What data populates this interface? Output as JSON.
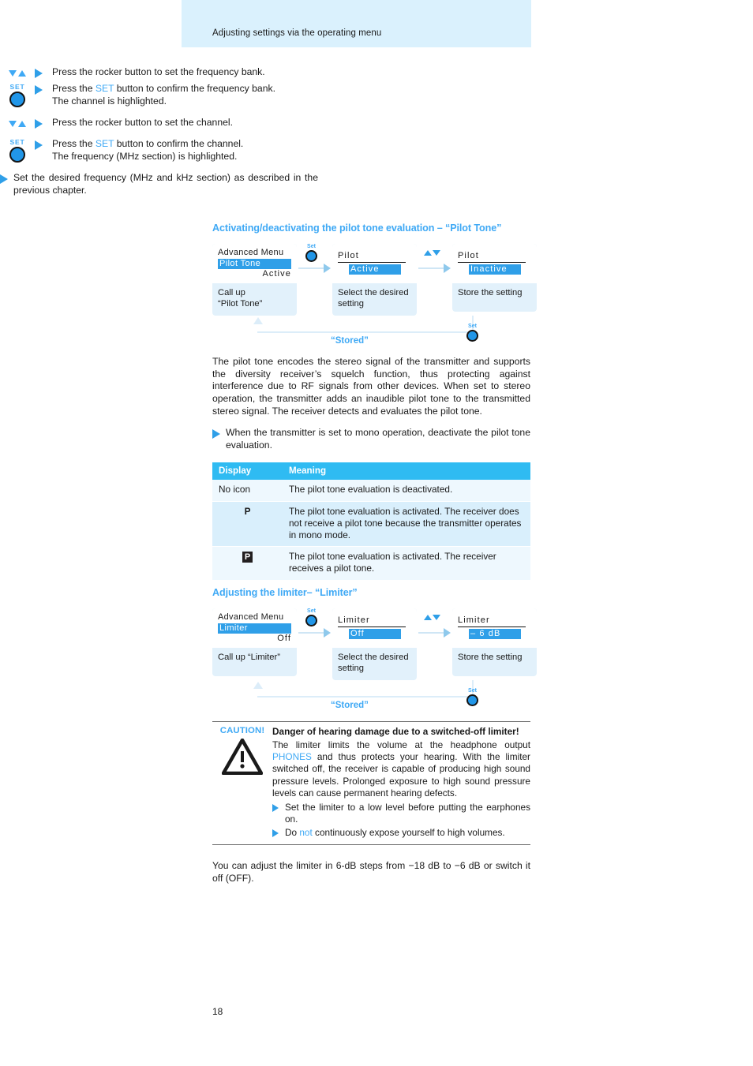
{
  "header": {
    "title": "Adjusting settings via the operating menu",
    "band_color": "#daf1fd"
  },
  "colors": {
    "accent": "#3fa9f5",
    "arrow": "#2f9fe8",
    "table_header": "#2fbbf2",
    "table_row_alt": "#d9effc",
    "table_row_plain": "#eef8fe",
    "card_body": "#e2f1fb"
  },
  "steps": [
    {
      "icon": "rocker-down-up",
      "lines": [
        "Press the rocker button to set the frequency bank."
      ]
    },
    {
      "icon": "set-button",
      "icon_label": "SET",
      "lines": [
        "Press the SET button to confirm the frequency bank.",
        "The channel is highlighted."
      ],
      "keyword": "SET"
    },
    {
      "icon": "rocker-down-up",
      "lines": [
        "Press the rocker button to set the channel."
      ]
    },
    {
      "icon": "set-button",
      "icon_label": "SET",
      "lines": [
        "Press the SET button to confirm the channel.",
        "The frequency (MHz section) is highlighted."
      ],
      "keyword": "SET"
    }
  ],
  "frequency_bullet": "Set the desired frequency (MHz and kHz section) as described in the previous chapter.",
  "pilot_section": {
    "heading": "Activating/deactivating the pilot tone evaluation – “Pilot Tone”",
    "cards": [
      {
        "screen": {
          "line1": "Advanced  Menu",
          "line2": "Pilot Tone",
          "line3": "Active"
        },
        "caption": "Call up\n“Pilot Tone”"
      },
      {
        "screen": {
          "line1": "Pilot",
          "line2": "Active"
        },
        "caption": "Select the desired setting"
      },
      {
        "screen": {
          "line1": "Pilot",
          "line2": "Inactive"
        },
        "caption": "Store the setting"
      }
    ],
    "connector1": {
      "type": "set-button",
      "label": "Set"
    },
    "connector2": {
      "type": "rocker-up-down"
    },
    "return_label": "“Stored”",
    "return_button_label": "Set"
  },
  "pilot_paragraph": "The pilot tone encodes the stereo signal of the transmitter and supports the diversity receiver’s squelch function, thus protecting against interference due to RF signals from other devices. When set to stereo operation, the transmitter adds an inaudible pilot tone to the transmitted stereo signal. The receiver detects and evaluates the pilot tone.",
  "pilot_bullet": "When the transmitter is set to mono operation, deactivate the pilot tone evaluation.",
  "table": {
    "headers": [
      "Display",
      "Meaning"
    ],
    "rows": [
      {
        "display": "No icon",
        "display_kind": "text",
        "meaning": "The pilot tone evaluation is deactivated."
      },
      {
        "display": "P",
        "display_kind": "plain-p",
        "meaning": "The pilot tone evaluation is activated. The receiver does not receive a pilot tone because the transmitter operates in mono mode."
      },
      {
        "display": "P",
        "display_kind": "boxed-p",
        "meaning": "The pilot tone evaluation is activated. The receiver receives a pilot tone."
      }
    ]
  },
  "limiter_section": {
    "heading": "Adjusting the limiter– “Limiter”",
    "cards": [
      {
        "screen": {
          "line1": "Advanced  Menu",
          "line2": "Limiter",
          "line3": "Off"
        },
        "caption": "Call up “Limiter”"
      },
      {
        "screen": {
          "line1": "Limiter",
          "line2": "Off"
        },
        "caption": "Select the desired setting"
      },
      {
        "screen": {
          "line1": "Limiter",
          "line2": "– 6 dB"
        },
        "caption": "Store the setting"
      }
    ],
    "connector1": {
      "type": "set-button",
      "label": "Set"
    },
    "connector2": {
      "type": "rocker-up-down"
    },
    "return_label": "“Stored”",
    "return_button_label": "Set"
  },
  "caution": {
    "word": "CAUTION!",
    "icon": "warning-triangle",
    "title": "Danger of hearing damage due to a switched-off limiter!",
    "body_pre": "The limiter limits the volume at the headphone output ",
    "body_kw": "PHONES",
    "body_post": " and thus protects your hearing. With the limiter switched off, the receiver is capable of producing high sound pressure levels. Prolonged exposure to high sound pressure levels can cause permanent hearing defects.",
    "bullets": [
      {
        "pre": "Set the limiter to a low level before putting the earphones on.",
        "kw": "",
        "post": ""
      },
      {
        "pre": "Do ",
        "kw": "not",
        "post": " continuously expose yourself to high volumes."
      }
    ]
  },
  "closing_paragraph": "You can adjust the limiter in 6-dB steps from −18 dB to −6 dB or switch it off (OFF).",
  "page_number": "18"
}
